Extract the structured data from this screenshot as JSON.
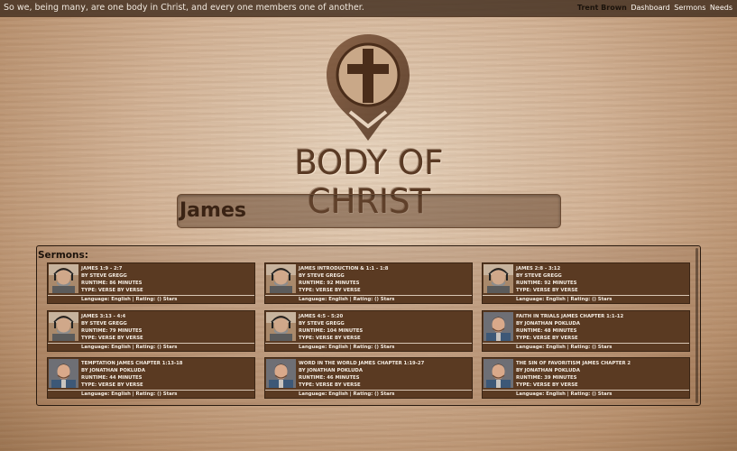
{
  "header": {
    "verse": "So we, being many, are one body in Christ, and every one members one of another.",
    "user": "Trent Brown",
    "nav": [
      "Dashboard",
      "Sermons",
      "Needs"
    ]
  },
  "brand": {
    "name": "BODY OF CHRIST"
  },
  "search": {
    "value": "James"
  },
  "sermons": {
    "title": "Sermons:",
    "items": [
      {
        "title": "JAMES 1:9 - 2:7",
        "speaker": "BY STEVE GREGG",
        "runtime": "RUNTIME: 86 MINUTES",
        "type": "TYPE: VERSE BY VERSE",
        "meta": "Language: English | Rating: () Stars",
        "avatar": "bald"
      },
      {
        "title": "JAMES INTRODUCTION & 1:1 - 1:8",
        "speaker": "BY STEVE GREGG",
        "runtime": "RUNTIME: 92 MINUTES",
        "type": "TYPE: VERSE BY VERSE",
        "meta": "Language: English | Rating: () Stars",
        "avatar": "bald"
      },
      {
        "title": "JAMES 2:8 - 3:12",
        "speaker": "BY STEVE GREGG",
        "runtime": "RUNTIME: 92 MINUTES",
        "type": "TYPE: VERSE BY VERSE",
        "meta": "Language: English | Rating: () Stars",
        "avatar": "bald"
      },
      {
        "title": "JAMES 3:13 - 4:4",
        "speaker": "BY STEVE GREGG",
        "runtime": "RUNTIME: 79 MINUTES",
        "type": "TYPE: VERSE BY VERSE",
        "meta": "Language: English | Rating: () Stars",
        "avatar": "bald"
      },
      {
        "title": "JAMES 4:5 - 5:20",
        "speaker": "BY STEVE GREGG",
        "runtime": "RUNTIME: 104 MINUTES",
        "type": "TYPE: VERSE BY VERSE",
        "meta": "Language: English | Rating: () Stars",
        "avatar": "bald"
      },
      {
        "title": "FAITH IN TRIALS JAMES CHAPTER 1:1-12",
        "speaker": "BY JONATHAN POKLUDA",
        "runtime": "RUNTIME: 48 MINUTES",
        "type": "TYPE: VERSE BY VERSE",
        "meta": "Language: English | Rating: () Stars",
        "avatar": "young"
      },
      {
        "title": "TEMPTATION JAMES CHAPTER 1:13-18",
        "speaker": "BY JONATHAN POKLUDA",
        "runtime": "RUNTIME: 44 MINUTES",
        "type": "TYPE: VERSE BY VERSE",
        "meta": "Language: English | Rating: () Stars",
        "avatar": "young"
      },
      {
        "title": "WORD IN THE WORLD JAMES CHAPTER 1:19-27",
        "speaker": "BY JONATHAN POKLUDA",
        "runtime": "RUNTIME: 46 MINUTES",
        "type": "TYPE: VERSE BY VERSE",
        "meta": "Language: English | Rating: () Stars",
        "avatar": "young"
      },
      {
        "title": "THE SIN OF FAVORITISM JAMES CHAPTER 2",
        "speaker": "BY JONATHAN POKLUDA",
        "runtime": "RUNTIME: 39 MINUTES",
        "type": "TYPE: VERSE BY VERSE",
        "meta": "Language: English | Rating: () Stars",
        "avatar": "young"
      }
    ]
  },
  "colors": {
    "card": "#5a3a22",
    "brand_text": "#5a3a24",
    "header_bg": "#46322a"
  }
}
